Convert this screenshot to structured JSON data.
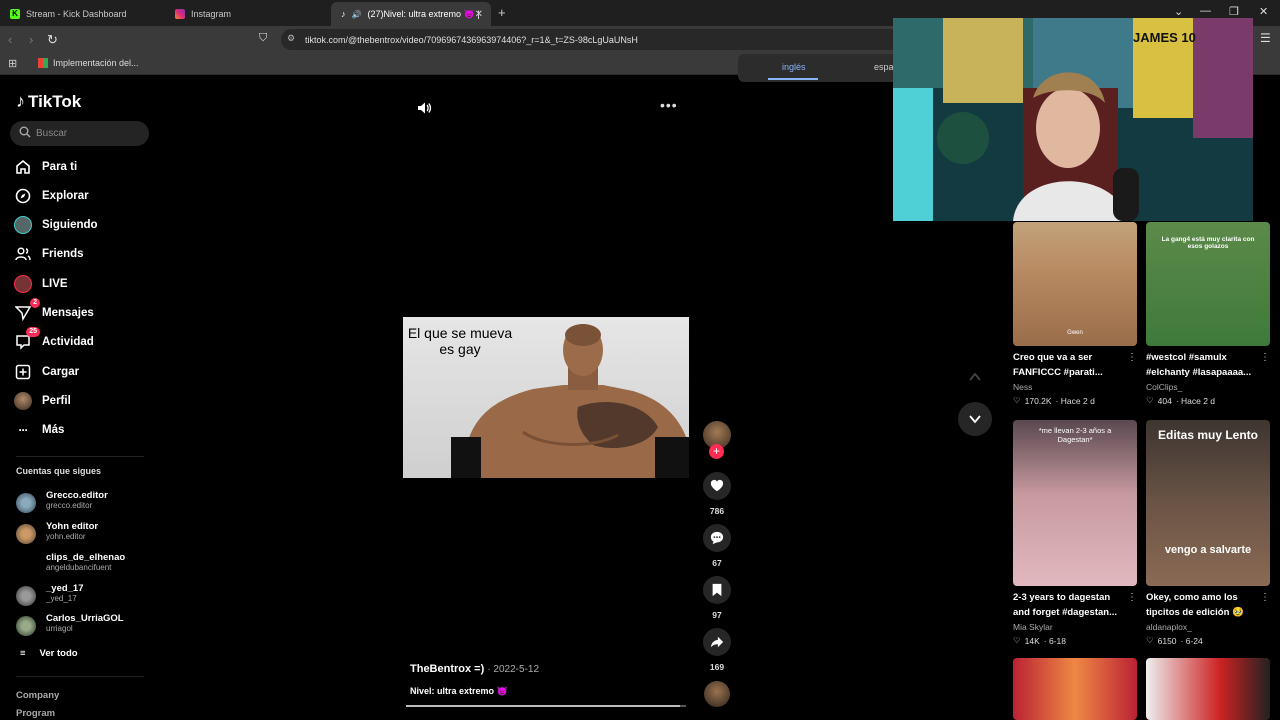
{
  "browser": {
    "tabs": [
      {
        "title": "Stream - Kick Dashboard",
        "favicon_color": "#53fc18"
      },
      {
        "title": "Instagram",
        "favicon_color": "#e1306c"
      },
      {
        "title": "(27)Nivel: ultra extremo 👿 |",
        "favicon_color": "#ffffff"
      }
    ],
    "url": "tiktok.com/@thebentrox/video/7096967436963974406?_r=1&_t=ZS-98cLgUaUNsH",
    "bookmark": "Implementación del...",
    "translate": {
      "active": "inglés",
      "other": "espa"
    }
  },
  "sidebar": {
    "logo": "TikTok",
    "search_placeholder": "Buscar",
    "nav": [
      {
        "label": "Para ti",
        "icon": "home-icon"
      },
      {
        "label": "Explorar",
        "icon": "compass-icon"
      },
      {
        "label": "Siguiendo",
        "icon": "following-avatar-icon"
      },
      {
        "label": "Friends",
        "icon": "friends-icon"
      },
      {
        "label": "LIVE",
        "icon": "live-icon"
      },
      {
        "label": "Mensajes",
        "icon": "messages-icon",
        "badge": "2"
      },
      {
        "label": "Actividad",
        "icon": "activity-icon",
        "badge": "25"
      },
      {
        "label": "Cargar",
        "icon": "upload-icon"
      },
      {
        "label": "Perfil",
        "icon": "profile-icon"
      },
      {
        "label": "Más",
        "icon": "more-icon"
      }
    ],
    "following_title": "Cuentas que sigues",
    "following": [
      {
        "name": "Grecco.editor",
        "handle": "grecco.editor"
      },
      {
        "name": "Yohn editor",
        "handle": "yohn.editor"
      },
      {
        "name": "clips_de_elhenao",
        "handle": "angeldubancifuent"
      },
      {
        "name": "_yed_17",
        "handle": "_yed_17"
      },
      {
        "name": "Carlos_UrriaGOL",
        "handle": "urriagol"
      }
    ],
    "see_all": "Ver todo",
    "footer": [
      "Company",
      "Program"
    ]
  },
  "video": {
    "overlay_text": "El que se mueva es gay",
    "author": "TheBentrox =)",
    "date": "· 2022-5-12",
    "description": "Nivel: ultra extremo 👿",
    "progress": 0.98,
    "actions": {
      "likes": "786",
      "comments": "67",
      "saves": "97",
      "shares": "169"
    }
  },
  "recommended": [
    {
      "title": "Creo que va a ser FANFICCC #parati...",
      "user": "Ness",
      "likes": "170.2K",
      "time": "· Hace 2 d",
      "thumb_text": "Gwen"
    },
    {
      "title": "#westcol #samulx #elchanty #lasapaaaa...",
      "user": "ColClips_",
      "likes": "404",
      "time": "· Hace 2 d",
      "thumb_text": "La gang4 está muy clarita con esos golazos"
    },
    {
      "title": "2-3 years to dagestan and forget #dagestan...",
      "user": "Mia Skylar",
      "likes": "14K",
      "time": "· 6-18",
      "thumb_text": "*me llevan 2-3 años a Dagestan*"
    },
    {
      "title": "Okey, como amo los tipcitos de edición 🥹",
      "user": "aldanaplox_",
      "likes": "6150",
      "time": "· 6-24",
      "thumb_text": "Editas muy Lento",
      "thumb_text2": "vengo a salvarte"
    }
  ],
  "webcam": {
    "poster_text": "JAMES 10"
  }
}
